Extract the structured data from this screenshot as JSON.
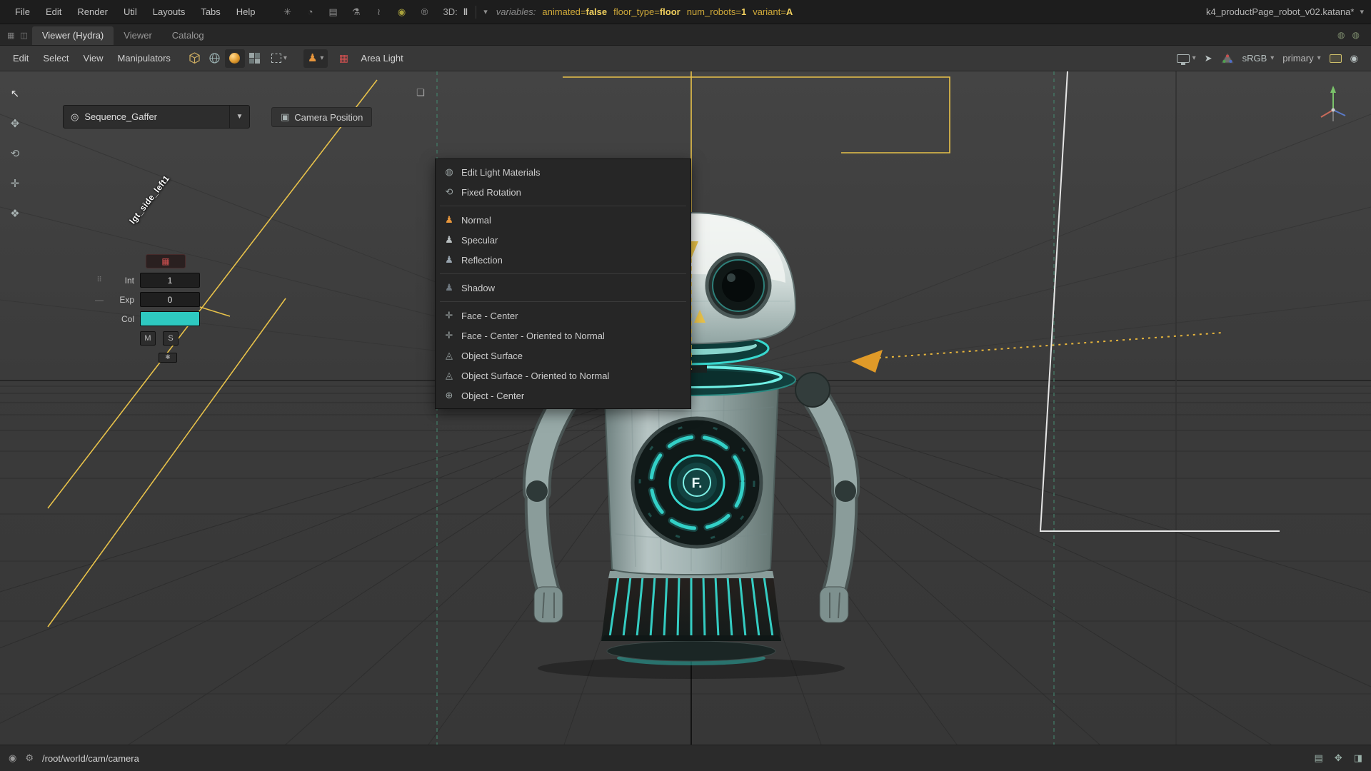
{
  "window": {
    "title": "k4_productPage_robot_v02.katana*"
  },
  "menubar": {
    "menus": [
      "File",
      "Edit",
      "Render",
      "Util",
      "Layouts",
      "Tabs",
      "Help"
    ],
    "mode_label": "3D:",
    "variables_label": "variables:",
    "variables": [
      {
        "key": "animated=",
        "value": "false"
      },
      {
        "key": "floor_type=",
        "value": "floor"
      },
      {
        "key": "num_robots=",
        "value": "1"
      },
      {
        "key": "variant=",
        "value": "A"
      }
    ]
  },
  "tabbar": {
    "tabs": [
      "Viewer (Hydra)",
      "Viewer",
      "Catalog"
    ]
  },
  "toolbar": {
    "menus": [
      "Edit",
      "Select",
      "View",
      "Manipulators"
    ],
    "area_light_label": "Area Light",
    "colorspace": "sRGB",
    "view_name": "primary"
  },
  "hud": {
    "gaffer_name": "Sequence_Gaffer",
    "camera_button_label": "Camera Position"
  },
  "light_menu": {
    "items": [
      "Edit Light Materials",
      "Fixed Rotation",
      "Normal",
      "Specular",
      "Reflection",
      "Shadow",
      "Face - Center",
      "Face - Center - Oriented to Normal",
      "Object Surface",
      "Object Surface - Oriented to Normal",
      "Object - Center"
    ]
  },
  "light_panel": {
    "light_name": "lgt_side_left1",
    "int_label": "Int",
    "int_value": "1",
    "exp_label": "Exp",
    "exp_value": "0",
    "col_label": "Col",
    "col_color": "#2ec9c0",
    "col_swatch_style": "background:#2ec9c0",
    "mute_label": "M",
    "solo_label": "S"
  },
  "robot": {
    "chest_badge": "F."
  },
  "statusbar": {
    "path": "/root/world/cam/camera"
  },
  "colors": {
    "accent_yellow": "#e8c24a",
    "teal": "#2ec9c0",
    "area_light_red": "#cf5050",
    "selection_green": "#44806a"
  },
  "icons": {
    "settings": "✳",
    "exposure": "◔",
    "slate": "▤",
    "flask": "⚗",
    "probe": "≀",
    "record": "◉",
    "registered": "®",
    "pause": "‖",
    "caret": "▾",
    "caret_down": "▼",
    "tab_grid": "▦",
    "tab_split": "◫",
    "tab_circle_a": "◍",
    "tab_circle_b": "◍",
    "light_person": "♟",
    "area_light": "▦",
    "pointer_flag": "➤",
    "gaffer_source": "◎",
    "camera_position": "▣",
    "link": "❏",
    "select_arrow": "↖",
    "tool_translate": "✥",
    "tool_rotate": "⟲",
    "tool_scale": "✛",
    "tool_pivot": "❖",
    "menu_materials": "◍",
    "menu_fixed_rotation": "⟲",
    "menu_face_center": "✛",
    "menu_object_surface": "◬",
    "menu_object_center": "⊕",
    "panel_drag": "⠿",
    "panel_expand": "—",
    "panel_star": "✱",
    "eye": "◉",
    "gear": "⚙",
    "status_image": "▤",
    "status_pan": "✥",
    "status_camera": "◨",
    "loupe": "◉"
  }
}
